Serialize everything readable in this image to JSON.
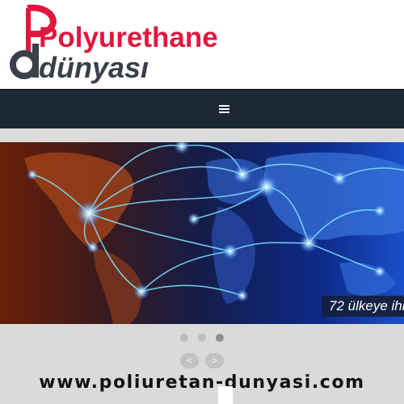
{
  "logo": {
    "line1": "Polyurethane",
    "line2": "dünyası"
  },
  "navbar": {
    "menu_icon": "hamburger-menu-icon"
  },
  "slider": {
    "caption": "72 ülkeye ihr",
    "dots": [
      {
        "active": false
      },
      {
        "active": false
      },
      {
        "active": true
      }
    ],
    "prev_label": "<",
    "next_label": ">"
  },
  "footer": {
    "website": "www.poliuretan-dunyasi.com"
  },
  "colors": {
    "brand_red": "#e3173e",
    "brand_dark": "#3a3f4a",
    "navbar": "#1c2833"
  }
}
